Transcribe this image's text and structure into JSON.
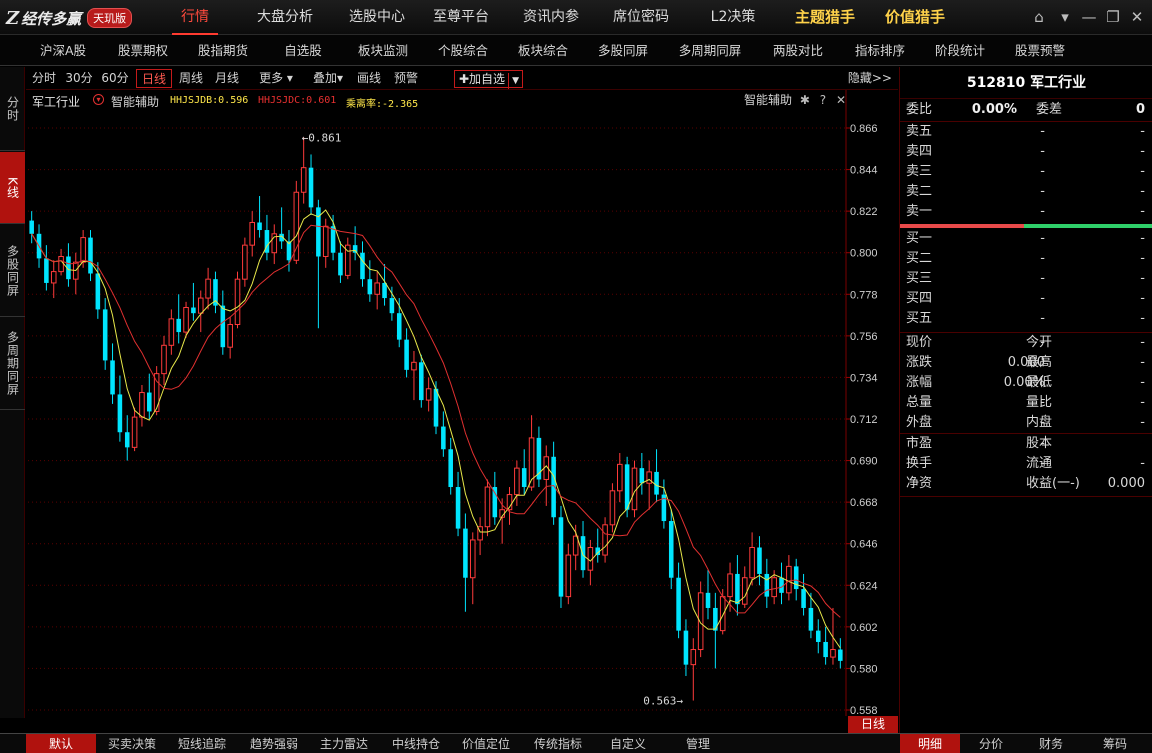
{
  "logo": {
    "mark": "Z",
    "text": "经传多赢",
    "badge": "天玑版"
  },
  "topnav": [
    {
      "label": "行情",
      "active": true
    },
    {
      "label": "大盘分析"
    },
    {
      "label": "选股中心"
    },
    {
      "label": "至尊平台"
    },
    {
      "label": "资讯内参"
    },
    {
      "label": "席位密码"
    },
    {
      "label": "L2决策"
    },
    {
      "label": "主题猎手",
      "highlight": true
    },
    {
      "label": "价值猎手",
      "highlight": true
    }
  ],
  "window_buttons": {
    "home": "⌂",
    "menu": "▾",
    "minimize": "—",
    "restore": "❐",
    "close": "✕"
  },
  "subnav": [
    "沪深A股",
    "股票期权",
    "股指期货",
    "自选股",
    "板块监测",
    "个股综合",
    "板块综合",
    "多股同屏",
    "多周期同屏",
    "两股对比",
    "指标排序",
    "阶段统计",
    "股票预警"
  ],
  "left_tabs": [
    {
      "label": "分时"
    },
    {
      "label": "K线",
      "active": true
    },
    {
      "label": "多股同屏"
    },
    {
      "label": "多周期同屏"
    }
  ],
  "period_tabs": [
    {
      "label": "分时"
    },
    {
      "label": "30分"
    },
    {
      "label": "60分"
    },
    {
      "label": "日线",
      "active": true
    },
    {
      "label": "周线"
    },
    {
      "label": "月线"
    },
    {
      "label": "更多 ▾"
    },
    {
      "label": "叠加▾"
    },
    {
      "label": "画线"
    },
    {
      "label": "预警"
    }
  ],
  "add_favorite": "✚加自选",
  "add_favorite_dropdown": "▼",
  "hide_label": "隐藏>>",
  "indicator": {
    "name": "军工行业",
    "assist": "智能辅助",
    "hhjsjdb": "HHJSJDB:0.596",
    "hhjsjdc": "HHJSJDC:0.601",
    "deviation": "乘离率:-2.365",
    "assist_right": "智能辅助",
    "gear": "✱",
    "help": "?",
    "close": "✕"
  },
  "colors": {
    "up": "#ff3b3b",
    "down": "#00e5ff",
    "ma_yellow": "#e8e84a",
    "ma_red": "#e03030",
    "grid": "#5a0000"
  },
  "chart_data": {
    "type": "candlestick",
    "ylim": [
      0.558,
      0.866
    ],
    "yticks": [
      "0.866",
      "0.844",
      "0.822",
      "0.800",
      "0.778",
      "0.756",
      "0.734",
      "0.712",
      "0.690",
      "0.668",
      "0.646",
      "0.624",
      "0.602",
      "0.580",
      "0.558"
    ],
    "max_label": "←0.861",
    "min_label": "0.563→",
    "max_value": 0.861,
    "min_value": 0.563,
    "ohlc": [
      [
        0.817,
        0.822,
        0.805,
        0.81
      ],
      [
        0.81,
        0.815,
        0.792,
        0.797
      ],
      [
        0.797,
        0.804,
        0.78,
        0.784
      ],
      [
        0.784,
        0.796,
        0.776,
        0.79
      ],
      [
        0.79,
        0.802,
        0.788,
        0.798
      ],
      [
        0.798,
        0.805,
        0.782,
        0.786
      ],
      [
        0.786,
        0.8,
        0.778,
        0.795
      ],
      [
        0.795,
        0.812,
        0.792,
        0.808
      ],
      [
        0.808,
        0.812,
        0.785,
        0.789
      ],
      [
        0.789,
        0.795,
        0.765,
        0.77
      ],
      [
        0.77,
        0.776,
        0.738,
        0.743
      ],
      [
        0.743,
        0.752,
        0.72,
        0.725
      ],
      [
        0.725,
        0.735,
        0.7,
        0.705
      ],
      [
        0.705,
        0.714,
        0.69,
        0.697
      ],
      [
        0.697,
        0.718,
        0.695,
        0.713
      ],
      [
        0.713,
        0.73,
        0.708,
        0.726
      ],
      [
        0.726,
        0.736,
        0.712,
        0.716
      ],
      [
        0.716,
        0.74,
        0.714,
        0.736
      ],
      [
        0.736,
        0.756,
        0.73,
        0.751
      ],
      [
        0.751,
        0.77,
        0.746,
        0.765
      ],
      [
        0.765,
        0.778,
        0.752,
        0.758
      ],
      [
        0.758,
        0.774,
        0.755,
        0.771
      ],
      [
        0.771,
        0.784,
        0.764,
        0.768
      ],
      [
        0.768,
        0.78,
        0.758,
        0.776
      ],
      [
        0.776,
        0.792,
        0.77,
        0.786
      ],
      [
        0.786,
        0.79,
        0.768,
        0.772
      ],
      [
        0.772,
        0.78,
        0.746,
        0.75
      ],
      [
        0.75,
        0.766,
        0.744,
        0.762
      ],
      [
        0.762,
        0.79,
        0.76,
        0.786
      ],
      [
        0.786,
        0.808,
        0.782,
        0.804
      ],
      [
        0.804,
        0.822,
        0.798,
        0.816
      ],
      [
        0.816,
        0.83,
        0.808,
        0.812
      ],
      [
        0.812,
        0.82,
        0.796,
        0.8
      ],
      [
        0.8,
        0.815,
        0.794,
        0.81
      ],
      [
        0.81,
        0.824,
        0.802,
        0.806
      ],
      [
        0.806,
        0.812,
        0.79,
        0.796
      ],
      [
        0.796,
        0.838,
        0.794,
        0.832
      ],
      [
        0.832,
        0.861,
        0.826,
        0.845
      ],
      [
        0.845,
        0.852,
        0.82,
        0.824
      ],
      [
        0.824,
        0.828,
        0.76,
        0.798
      ],
      [
        0.798,
        0.818,
        0.792,
        0.814
      ],
      [
        0.814,
        0.82,
        0.796,
        0.8
      ],
      [
        0.8,
        0.806,
        0.784,
        0.788
      ],
      [
        0.788,
        0.808,
        0.786,
        0.804
      ],
      [
        0.804,
        0.814,
        0.796,
        0.8
      ],
      [
        0.8,
        0.806,
        0.782,
        0.786
      ],
      [
        0.786,
        0.796,
        0.774,
        0.778
      ],
      [
        0.778,
        0.79,
        0.77,
        0.784
      ],
      [
        0.784,
        0.794,
        0.772,
        0.776
      ],
      [
        0.776,
        0.782,
        0.764,
        0.768
      ],
      [
        0.768,
        0.776,
        0.75,
        0.754
      ],
      [
        0.754,
        0.76,
        0.734,
        0.738
      ],
      [
        0.738,
        0.748,
        0.722,
        0.742
      ],
      [
        0.742,
        0.746,
        0.718,
        0.722
      ],
      [
        0.722,
        0.734,
        0.716,
        0.728
      ],
      [
        0.728,
        0.732,
        0.704,
        0.708
      ],
      [
        0.708,
        0.716,
        0.692,
        0.696
      ],
      [
        0.696,
        0.702,
        0.672,
        0.676
      ],
      [
        0.676,
        0.684,
        0.65,
        0.654
      ],
      [
        0.654,
        0.662,
        0.61,
        0.628
      ],
      [
        0.628,
        0.652,
        0.614,
        0.648
      ],
      [
        0.648,
        0.66,
        0.64,
        0.655
      ],
      [
        0.655,
        0.68,
        0.65,
        0.676
      ],
      [
        0.676,
        0.684,
        0.656,
        0.66
      ],
      [
        0.66,
        0.67,
        0.646,
        0.664
      ],
      [
        0.664,
        0.676,
        0.656,
        0.672
      ],
      [
        0.672,
        0.69,
        0.666,
        0.686
      ],
      [
        0.686,
        0.696,
        0.672,
        0.676
      ],
      [
        0.676,
        0.714,
        0.674,
        0.702
      ],
      [
        0.702,
        0.708,
        0.676,
        0.68
      ],
      [
        0.68,
        0.698,
        0.666,
        0.692
      ],
      [
        0.692,
        0.7,
        0.656,
        0.66
      ],
      [
        0.66,
        0.666,
        0.612,
        0.618
      ],
      [
        0.618,
        0.646,
        0.614,
        0.64
      ],
      [
        0.64,
        0.656,
        0.632,
        0.65
      ],
      [
        0.65,
        0.658,
        0.628,
        0.632
      ],
      [
        0.632,
        0.648,
        0.624,
        0.644
      ],
      [
        0.644,
        0.654,
        0.636,
        0.64
      ],
      [
        0.64,
        0.66,
        0.636,
        0.656
      ],
      [
        0.656,
        0.678,
        0.652,
        0.674
      ],
      [
        0.674,
        0.694,
        0.668,
        0.688
      ],
      [
        0.688,
        0.692,
        0.66,
        0.664
      ],
      [
        0.664,
        0.69,
        0.66,
        0.686
      ],
      [
        0.686,
        0.694,
        0.672,
        0.678
      ],
      [
        0.678,
        0.69,
        0.664,
        0.684
      ],
      [
        0.684,
        0.696,
        0.668,
        0.672
      ],
      [
        0.672,
        0.68,
        0.654,
        0.658
      ],
      [
        0.658,
        0.664,
        0.622,
        0.628
      ],
      [
        0.628,
        0.636,
        0.596,
        0.6
      ],
      [
        0.6,
        0.606,
        0.576,
        0.582
      ],
      [
        0.582,
        0.596,
        0.563,
        0.59
      ],
      [
        0.59,
        0.626,
        0.586,
        0.62
      ],
      [
        0.62,
        0.632,
        0.606,
        0.612
      ],
      [
        0.612,
        0.62,
        0.58,
        0.6
      ],
      [
        0.6,
        0.622,
        0.598,
        0.618
      ],
      [
        0.618,
        0.636,
        0.61,
        0.63
      ],
      [
        0.63,
        0.64,
        0.608,
        0.614
      ],
      [
        0.614,
        0.634,
        0.612,
        0.628
      ],
      [
        0.628,
        0.652,
        0.624,
        0.644
      ],
      [
        0.644,
        0.65,
        0.624,
        0.63
      ],
      [
        0.63,
        0.638,
        0.612,
        0.618
      ],
      [
        0.618,
        0.632,
        0.614,
        0.628
      ],
      [
        0.628,
        0.636,
        0.614,
        0.62
      ],
      [
        0.62,
        0.64,
        0.616,
        0.634
      ],
      [
        0.634,
        0.638,
        0.616,
        0.622
      ],
      [
        0.622,
        0.63,
        0.608,
        0.612
      ],
      [
        0.612,
        0.62,
        0.596,
        0.6
      ],
      [
        0.6,
        0.606,
        0.588,
        0.594
      ],
      [
        0.594,
        0.602,
        0.582,
        0.586
      ],
      [
        0.586,
        0.612,
        0.582,
        0.59
      ],
      [
        0.59,
        0.596,
        0.58,
        0.584
      ]
    ]
  },
  "day_label": "日线",
  "bottom_tabs": [
    {
      "label": "默认",
      "active": true
    },
    {
      "label": "买卖决策"
    },
    {
      "label": "短线追踪"
    },
    {
      "label": "趋势强弱"
    },
    {
      "label": "主力雷达"
    },
    {
      "label": "中线持仓"
    },
    {
      "label": "价值定位"
    },
    {
      "label": "传统指标"
    },
    {
      "label": "自定义"
    },
    {
      "label": "管理"
    }
  ],
  "right_bottom_tabs": [
    {
      "label": "明细",
      "active": true
    },
    {
      "label": "分价"
    },
    {
      "label": "财务"
    },
    {
      "label": "筹码"
    }
  ],
  "quote": {
    "title": "512810 军工行业",
    "weibi_label": "委比",
    "weibi_value": "0.00%",
    "weicha_label": "委差",
    "weicha_value": "0",
    "sell": [
      {
        "label": "卖五",
        "price": "-",
        "vol": "-"
      },
      {
        "label": "卖四",
        "price": "-",
        "vol": "-"
      },
      {
        "label": "卖三",
        "price": "-",
        "vol": "-"
      },
      {
        "label": "卖二",
        "price": "-",
        "vol": "-"
      },
      {
        "label": "卖一",
        "price": "-",
        "vol": "-"
      }
    ],
    "buy": [
      {
        "label": "买一",
        "price": "-",
        "vol": "-"
      },
      {
        "label": "买二",
        "price": "-",
        "vol": "-"
      },
      {
        "label": "买三",
        "price": "-",
        "vol": "-"
      },
      {
        "label": "买四",
        "price": "-",
        "vol": "-"
      },
      {
        "label": "买五",
        "price": "-",
        "vol": "-"
      }
    ],
    "stats": [
      {
        "l": "现价",
        "m": "-",
        "l2": "今开",
        "r": "-"
      },
      {
        "l": "涨跌",
        "m": "0.000",
        "l2": "最高",
        "r": "-"
      },
      {
        "l": "涨幅",
        "m": "0.00%",
        "l2": "最低",
        "r": "-"
      },
      {
        "l": "总量",
        "m": "-",
        "l2": "量比",
        "r": "-"
      },
      {
        "l": "外盘",
        "m": "-",
        "l2": "内盘",
        "r": "-"
      }
    ],
    "stats2": [
      {
        "l": "市盈",
        "m": "-",
        "l2": "股本",
        "r": ""
      },
      {
        "l": "换手",
        "m": "-",
        "l2": "流通",
        "r": "-"
      },
      {
        "l": "净资",
        "m": "-",
        "l2": "收益(一-)",
        "r": "0.000"
      }
    ]
  }
}
